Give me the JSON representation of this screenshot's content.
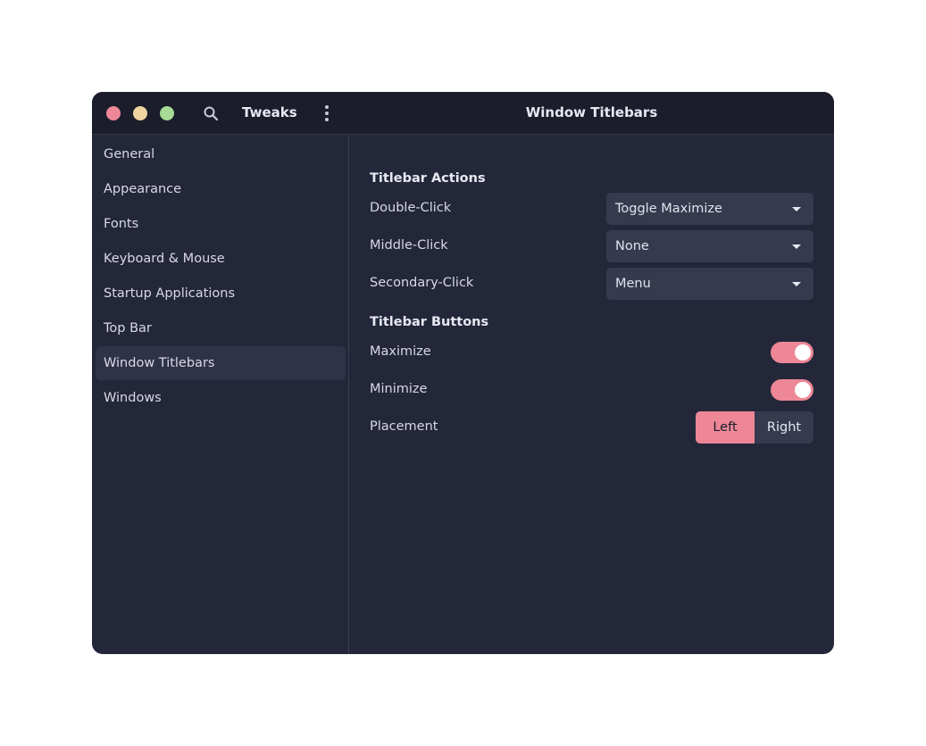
{
  "app": {
    "title": "Tweaks",
    "page_title": "Window Titlebars"
  },
  "titlebar": {
    "icons": [
      "close-icon",
      "minimize-icon",
      "maximize-icon",
      "search-icon",
      "kebab-menu-icon"
    ],
    "colors": {
      "close": "#ed8796",
      "minimize": "#eed49f",
      "maximize": "#a6da95"
    }
  },
  "sidebar": {
    "items": [
      {
        "label": "General"
      },
      {
        "label": "Appearance"
      },
      {
        "label": "Fonts"
      },
      {
        "label": "Keyboard & Mouse"
      },
      {
        "label": "Startup Applications"
      },
      {
        "label": "Top Bar"
      },
      {
        "label": "Window Titlebars",
        "active": true
      },
      {
        "label": "Windows"
      }
    ]
  },
  "main": {
    "actions_section": "Titlebar Actions",
    "double_click": {
      "label": "Double-Click",
      "value": "Toggle Maximize"
    },
    "middle_click": {
      "label": "Middle-Click",
      "value": "None"
    },
    "secondary_click": {
      "label": "Secondary-Click",
      "value": "Menu"
    },
    "buttons_section": "Titlebar Buttons",
    "maximize": {
      "label": "Maximize",
      "enabled": true
    },
    "minimize": {
      "label": "Minimize",
      "enabled": true
    },
    "placement": {
      "label": "Placement",
      "options": [
        "Left",
        "Right"
      ],
      "selected": "Left"
    }
  },
  "theme": {
    "accent": "#ed8796",
    "background": "#24273a",
    "titlebar_bg": "#1b1d2b",
    "control_bg": "#363a4f"
  }
}
